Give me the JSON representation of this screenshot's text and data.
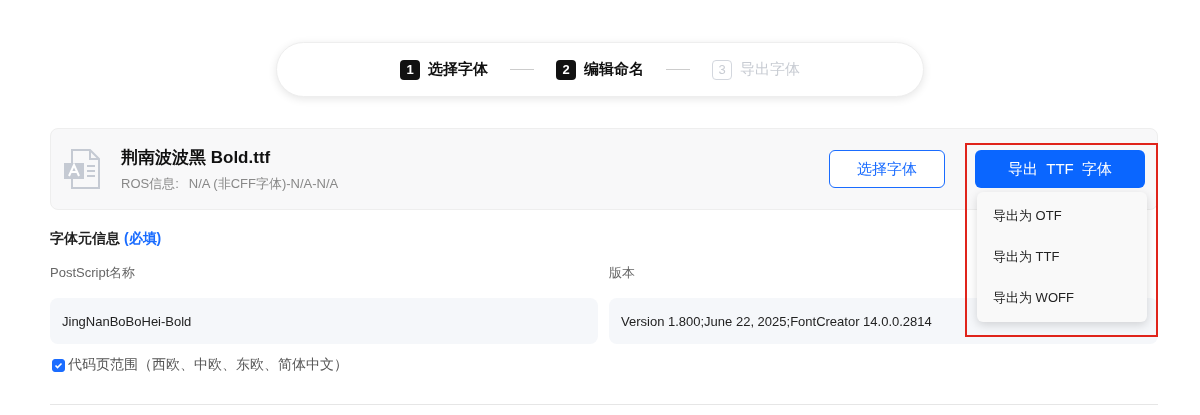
{
  "steps": [
    {
      "number": "1",
      "label": "选择字体",
      "disabled": false
    },
    {
      "number": "2",
      "label": "编辑命名",
      "disabled": false
    },
    {
      "number": "3",
      "label": "导出字体",
      "disabled": true
    }
  ],
  "file": {
    "name": "荆南波波黑 Bold.ttf",
    "ros_label": "ROS信息:",
    "ros_value": "N/A (非CFF字体)-N/A-N/A"
  },
  "buttons": {
    "choose": "选择字体",
    "export": "导出  TTF  字体"
  },
  "export_menu": {
    "items": [
      "导出为 OTF",
      "导出为 TTF",
      "导出为 WOFF"
    ]
  },
  "section": {
    "title": "字体元信息",
    "required": "(必填)"
  },
  "fields": [
    {
      "label": "PostScript名称",
      "value": "JingNanBoBoHei-Bold"
    },
    {
      "label": "版本",
      "value": "Version 1.800;June 22, 2025;FontCreator 14.0.0.2814"
    }
  ],
  "codepage": {
    "label": "代码页范围（西欧、中欧、东欧、简体中文）",
    "checked": true
  }
}
